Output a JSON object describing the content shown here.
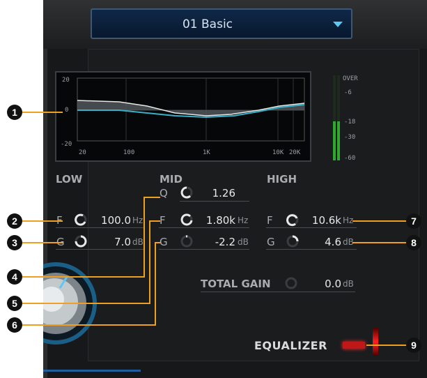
{
  "preset": {
    "name": "01 Basic"
  },
  "graph": {
    "y_labels": [
      "20",
      "0",
      "-20"
    ],
    "x_labels": [
      "20",
      "100",
      "1K",
      "10K",
      "20K"
    ]
  },
  "meter": {
    "labels": [
      "OVER",
      "-6",
      "-18",
      "-30",
      "-60"
    ]
  },
  "bands": {
    "low": {
      "title": "LOW",
      "f_label": "F",
      "f_value": "100.0",
      "f_unit": "Hz",
      "g_label": "G",
      "g_value": "7.0",
      "g_unit": "dB"
    },
    "mid": {
      "title": "MID",
      "q_label": "Q",
      "q_value": "1.26",
      "f_label": "F",
      "f_value": "1.80k",
      "f_unit": "Hz",
      "g_label": "G",
      "g_value": "-2.2",
      "g_unit": "dB"
    },
    "high": {
      "title": "HIGH",
      "f_label": "F",
      "f_value": "10.6k",
      "f_unit": "Hz",
      "g_label": "G",
      "g_value": "4.6",
      "g_unit": "dB"
    }
  },
  "total_gain": {
    "label": "TOTAL GAIN",
    "value": "0.0",
    "unit": "dB"
  },
  "equalizer": {
    "label": "EQUALIZER"
  },
  "callouts": [
    "1",
    "2",
    "3",
    "4",
    "5",
    "6",
    "7",
    "8",
    "9"
  ],
  "colors": {
    "accent": "#5fc8f0",
    "callout": "#f0a020",
    "led_on": "#c01818"
  }
}
